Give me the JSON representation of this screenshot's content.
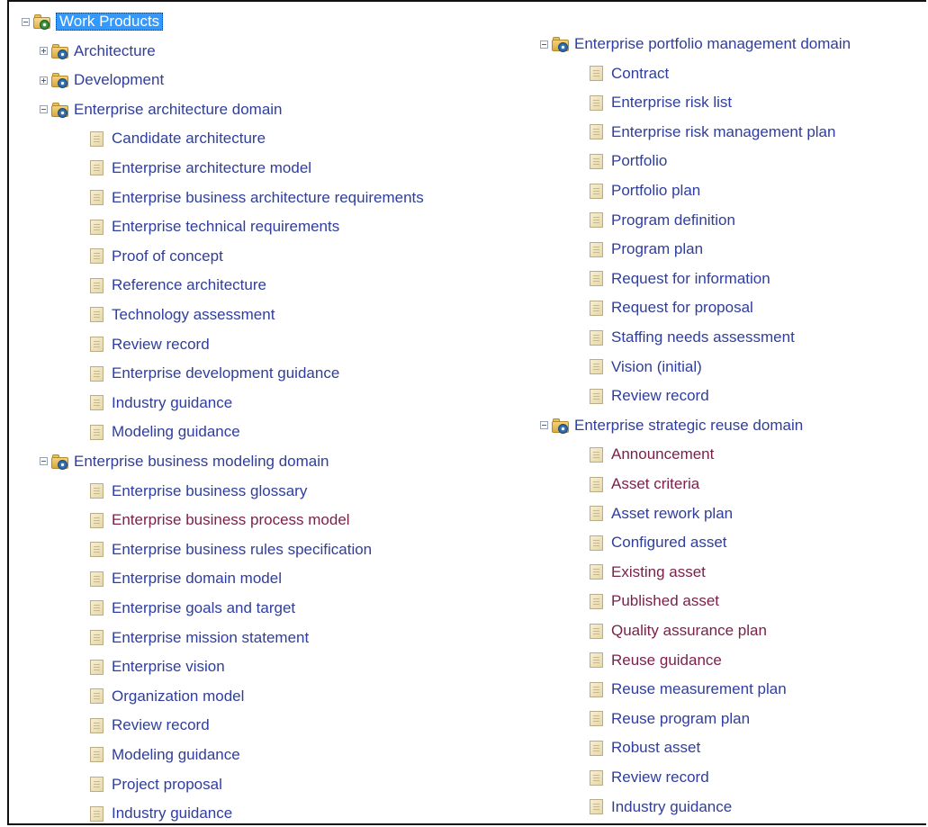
{
  "tree": {
    "root": {
      "label": "Work Products",
      "toggle": "minus",
      "selected": true
    },
    "left": [
      {
        "label": "Architecture",
        "kind": "package",
        "toggle": "plus"
      },
      {
        "label": "Development",
        "kind": "package",
        "toggle": "plus"
      },
      {
        "label": "Enterprise architecture domain",
        "kind": "package",
        "toggle": "minus",
        "children": [
          "Candidate architecture",
          "Enterprise architecture model",
          "Enterprise business architecture requirements",
          "Enterprise technical requirements",
          "Proof of concept",
          "Reference architecture",
          "Technology assessment",
          "Review record",
          "Enterprise development guidance",
          "Industry guidance",
          "Modeling guidance"
        ]
      },
      {
        "label": "Enterprise business modeling domain",
        "kind": "package",
        "toggle": "minus",
        "children": [
          "Enterprise business glossary",
          "Enterprise business process model",
          "Enterprise business rules specification",
          "Enterprise domain model",
          "Enterprise goals and target",
          "Enterprise mission statement",
          "Enterprise vision",
          "Organization model",
          "Review record",
          "Modeling guidance",
          "Project proposal",
          "Industry guidance"
        ],
        "visited": [
          "Enterprise business process model"
        ]
      }
    ],
    "right": [
      {
        "label": "Enterprise portfolio management domain",
        "kind": "package",
        "toggle": "minus",
        "children": [
          "Contract",
          "Enterprise risk list",
          "Enterprise risk management plan",
          "Portfolio",
          "Portfolio plan",
          "Program definition",
          "Program plan",
          "Request for information",
          "Request for proposal",
          "Staffing needs assessment",
          "Vision (initial)",
          "Review record"
        ]
      },
      {
        "label": "Enterprise strategic reuse domain",
        "kind": "package",
        "toggle": "minus",
        "children": [
          "Announcement",
          "Asset criteria",
          "Asset rework plan",
          "Configured asset",
          "Existing asset",
          "Published asset",
          "Quality assurance plan",
          "Reuse guidance",
          "Reuse measurement plan",
          "Reuse program plan",
          "Robust asset",
          "Review record",
          "Industry guidance"
        ],
        "visited": [
          "Announcement",
          "Asset criteria",
          "Existing asset",
          "Published asset",
          "Quality assurance plan",
          "Reuse guidance"
        ]
      }
    ]
  },
  "colors": {
    "link": "#2f3e9e",
    "visited": "#7a1f4a",
    "selection": "#3399ff"
  }
}
